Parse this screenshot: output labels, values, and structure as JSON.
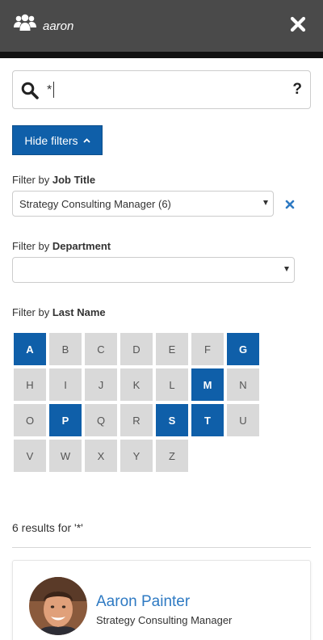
{
  "header": {
    "title": "aaron",
    "icon": "users-icon",
    "close_icon": "close-icon"
  },
  "search": {
    "value": "*",
    "help_label": "?"
  },
  "filters_toggle": {
    "label": "Hide filters"
  },
  "filters": {
    "job_title": {
      "prefix": "Filter by",
      "field": "Job Title",
      "selected": "Strategy Consulting Manager (6)"
    },
    "department": {
      "prefix": "Filter by",
      "field": "Department",
      "selected": ""
    },
    "last_name": {
      "prefix": "Filter by",
      "field": "Last Name"
    }
  },
  "letters": [
    {
      "l": "A",
      "on": true
    },
    {
      "l": "B",
      "on": false
    },
    {
      "l": "C",
      "on": false
    },
    {
      "l": "D",
      "on": false
    },
    {
      "l": "E",
      "on": false
    },
    {
      "l": "F",
      "on": false
    },
    {
      "l": "G",
      "on": true
    },
    {
      "l": "H",
      "on": false
    },
    {
      "l": "I",
      "on": false
    },
    {
      "l": "J",
      "on": false
    },
    {
      "l": "K",
      "on": false
    },
    {
      "l": "L",
      "on": false
    },
    {
      "l": "M",
      "on": true
    },
    {
      "l": "N",
      "on": false
    },
    {
      "l": "O",
      "on": false
    },
    {
      "l": "P",
      "on": true
    },
    {
      "l": "Q",
      "on": false
    },
    {
      "l": "R",
      "on": false
    },
    {
      "l": "S",
      "on": true
    },
    {
      "l": "T",
      "on": true
    },
    {
      "l": "U",
      "on": false
    },
    {
      "l": "V",
      "on": false
    },
    {
      "l": "W",
      "on": false
    },
    {
      "l": "X",
      "on": false
    },
    {
      "l": "Y",
      "on": false
    },
    {
      "l": "Z",
      "on": false
    }
  ],
  "results": {
    "summary": "6 results for '*'"
  },
  "people": [
    {
      "name": "Aaron Painter",
      "title": "Strategy Consulting Manager"
    }
  ],
  "colors": {
    "header": "#4a4a4a",
    "accent": "#0f5fa9",
    "link": "#2e7ac3",
    "letter_bg": "#d9d9d9"
  }
}
